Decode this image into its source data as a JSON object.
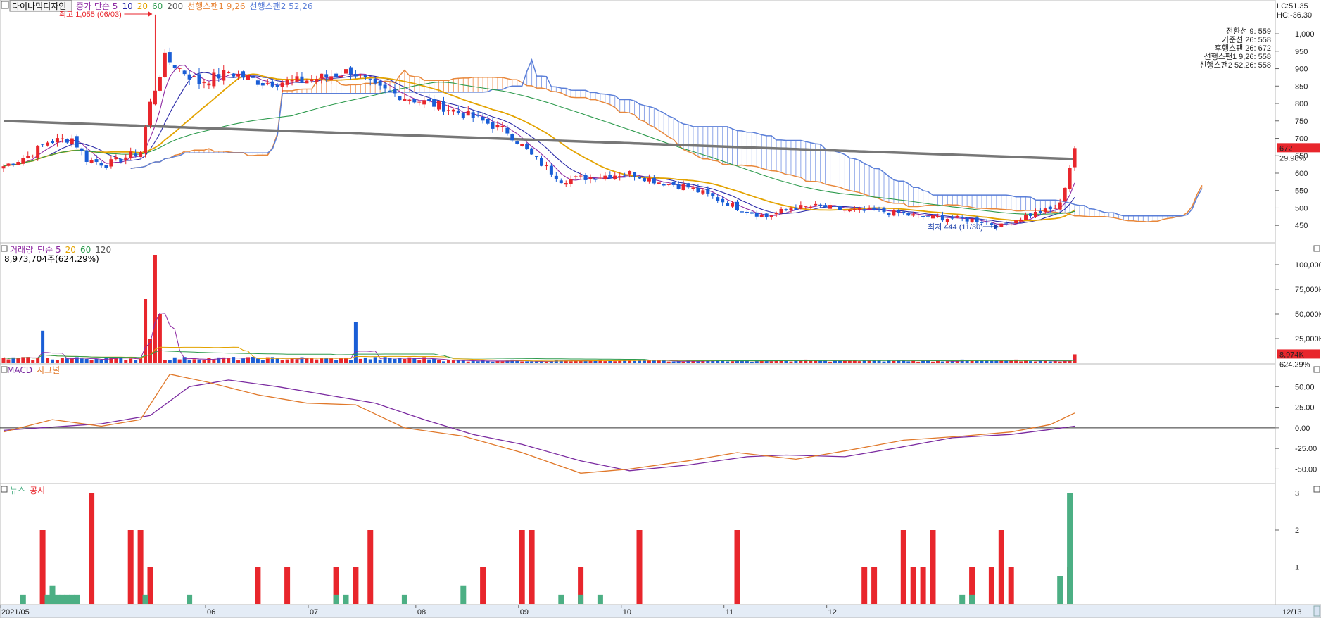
{
  "colors": {
    "up": "#e8262c",
    "down": "#1a5ed6",
    "ma5": "#8e2aa2",
    "ma10": "#2a2aa8",
    "ma20": "#e3a300",
    "ma60": "#2e9b4e",
    "ma200": "#777777",
    "span1": "#e8873a",
    "span2": "#5b7fd8",
    "tenkan": "#2e8b57",
    "kijun": "#555555",
    "chikou": "#8e2aa2",
    "macd": "#7a2aa0",
    "signal": "#e0782a",
    "news": "#4caf84",
    "disclosure": "#e8262c"
  },
  "price_panel": {
    "stock_name": "다이나믹디자인",
    "legend": [
      {
        "text": "종가 단순 5",
        "color": "#8e2aa2"
      },
      {
        "text": "10",
        "color": "#2a2aa8"
      },
      {
        "text": "20",
        "color": "#e3a300"
      },
      {
        "text": "60",
        "color": "#2e9b4e"
      },
      {
        "text": "200",
        "color": "#555555"
      },
      {
        "text": "선행스팬1 9,26",
        "color": "#e8873a"
      },
      {
        "text": "선행스팬2 52,26",
        "color": "#5b7fd8"
      }
    ],
    "lc": "LC:51.35",
    "hc": "HC:-36.30",
    "high_note": "최고 1,055 (06/03)",
    "low_note": "최저 444 (11/30)",
    "ichimoku_labels": [
      {
        "text": "전환선 9: 559",
        "color": "#2e8b57"
      },
      {
        "text": "기준선 26: 558",
        "color": "#555555"
      },
      {
        "text": "후행스팬 26: 672",
        "color": "#8e2aa2"
      },
      {
        "text": "선행스팬1 9,26: 558",
        "color": "#e8873a"
      },
      {
        "text": "선행스팬2 52,26: 558",
        "color": "#5b7fd8"
      }
    ],
    "last_price_label": "672",
    "last_change_label": "29.98%"
  },
  "volume_panel": {
    "legend": [
      {
        "text": "거래량",
        "color": "#8e2aa2"
      },
      {
        "text": "단순 5",
        "color": "#8e2aa2"
      },
      {
        "text": "20",
        "color": "#e3a300"
      },
      {
        "text": "60",
        "color": "#2e9b4e"
      },
      {
        "text": "120",
        "color": "#555555"
      }
    ],
    "last_volume_text": "8,973,704주(624.29%)",
    "last_volume_label": "8,974K",
    "last_volume_pct": "624.29%"
  },
  "macd_panel": {
    "legend": [
      {
        "text": "MACD",
        "color": "#7a2aa0"
      },
      {
        "text": "시그널",
        "color": "#e0782a"
      }
    ]
  },
  "news_panel": {
    "legend": [
      {
        "text": "뉴스",
        "color": "#4caf84"
      },
      {
        "text": "공시",
        "color": "#e8262c"
      }
    ]
  },
  "x_axis": {
    "labels": [
      "2021/05",
      "06",
      "07",
      "08",
      "09",
      "10",
      "11",
      "12"
    ],
    "end_label": "12/13"
  },
  "chart_data": [
    {
      "type": "candlestick",
      "title": "다이나믹디자인",
      "ylim": [
        410,
        1085
      ],
      "y_ticks": [
        "1,000",
        "950",
        "900",
        "850",
        "800",
        "750",
        "700",
        "650",
        "600",
        "550",
        "500",
        "450"
      ],
      "y_tick_values": [
        1000,
        950,
        900,
        850,
        800,
        750,
        700,
        650,
        600,
        550,
        500,
        450
      ],
      "price_anchors": [
        [
          0,
          620
        ],
        [
          5,
          650
        ],
        [
          9,
          690
        ],
        [
          14,
          700
        ],
        [
          17,
          640
        ],
        [
          21,
          625
        ],
        [
          28,
          662
        ],
        [
          30,
          800
        ],
        [
          33,
          930
        ],
        [
          36,
          900
        ],
        [
          40,
          860
        ],
        [
          46,
          890
        ],
        [
          53,
          860
        ],
        [
          61,
          865
        ],
        [
          67,
          880
        ],
        [
          71,
          895
        ],
        [
          76,
          845
        ],
        [
          83,
          815
        ],
        [
          90,
          790
        ],
        [
          96,
          760
        ],
        [
          103,
          720
        ],
        [
          108,
          650
        ],
        [
          114,
          580
        ],
        [
          121,
          590
        ],
        [
          128,
          600
        ],
        [
          134,
          575
        ],
        [
          140,
          560
        ],
        [
          146,
          525
        ],
        [
          151,
          495
        ],
        [
          156,
          475
        ],
        [
          161,
          500
        ],
        [
          167,
          505
        ],
        [
          173,
          492
        ],
        [
          180,
          490
        ],
        [
          187,
          476
        ],
        [
          194,
          470
        ],
        [
          199,
          465
        ],
        [
          204,
          448
        ],
        [
          209,
          478
        ],
        [
          214,
          495
        ],
        [
          216,
          510
        ],
        [
          219,
          672
        ]
      ],
      "candle_count": 220,
      "high_marker": {
        "index": 31,
        "value": 1055
      },
      "low_marker": {
        "index": 204,
        "value": 444
      },
      "last": {
        "price": 672,
        "change_pct": 29.98
      },
      "moving_averages": [
        "5",
        "10",
        "20",
        "60",
        "200"
      ],
      "ichimoku": {
        "span1_label": "선행스팬1 9,26",
        "span2_label": "선행스팬2 52,26"
      }
    },
    {
      "type": "bar",
      "title": "거래량",
      "ylim": [
        0,
        110000
      ],
      "y_ticks": [
        "100,000K",
        "75,000K",
        "50,000K",
        "25,000K"
      ],
      "y_tick_values": [
        100000,
        75000,
        50000,
        25000
      ],
      "unit": "K",
      "spikes": [
        {
          "index": 8,
          "value": 33000
        },
        {
          "index": 29,
          "value": 65000
        },
        {
          "index": 31,
          "value": 110000
        },
        {
          "index": 32,
          "value": 50000
        },
        {
          "index": 30,
          "value": 25000
        },
        {
          "index": 72,
          "value": 42000
        },
        {
          "index": 219,
          "value": 8974
        }
      ]
    },
    {
      "type": "line",
      "title": "MACD",
      "ylim": [
        -65,
        75
      ],
      "y_ticks": [
        "50.00",
        "25.00",
        "0.00",
        "-25.00",
        "-50.00"
      ],
      "y_tick_values": [
        50,
        25,
        0,
        -25,
        -50
      ],
      "series": [
        {
          "name": "MACD",
          "points": [
            [
              0,
              -3
            ],
            [
              20,
              5
            ],
            [
              30,
              15
            ],
            [
              38,
              50
            ],
            [
              46,
              58
            ],
            [
              56,
              50
            ],
            [
              66,
              40
            ],
            [
              76,
              30
            ],
            [
              86,
              10
            ],
            [
              96,
              -8
            ],
            [
              106,
              -20
            ],
            [
              118,
              -40
            ],
            [
              128,
              -52
            ],
            [
              140,
              -45
            ],
            [
              152,
              -35
            ],
            [
              160,
              -33
            ],
            [
              172,
              -35
            ],
            [
              182,
              -25
            ],
            [
              194,
              -12
            ],
            [
              206,
              -8
            ],
            [
              214,
              -2
            ],
            [
              219,
              2
            ]
          ]
        },
        {
          "name": "시그널",
          "points": [
            [
              0,
              -5
            ],
            [
              10,
              10
            ],
            [
              20,
              2
            ],
            [
              28,
              10
            ],
            [
              34,
              65
            ],
            [
              42,
              55
            ],
            [
              52,
              40
            ],
            [
              62,
              30
            ],
            [
              72,
              28
            ],
            [
              82,
              0
            ],
            [
              94,
              -10
            ],
            [
              106,
              -30
            ],
            [
              118,
              -55
            ],
            [
              128,
              -50
            ],
            [
              140,
              -40
            ],
            [
              150,
              -30
            ],
            [
              162,
              -38
            ],
            [
              172,
              -28
            ],
            [
              184,
              -15
            ],
            [
              196,
              -10
            ],
            [
              206,
              -5
            ],
            [
              214,
              4
            ],
            [
              219,
              18
            ]
          ]
        }
      ]
    },
    {
      "type": "bar",
      "title": "뉴스 / 공시",
      "ylim": [
        0,
        3.2
      ],
      "y_ticks": [
        "3",
        "2",
        "1"
      ],
      "y_tick_values": [
        3,
        2,
        1
      ],
      "series": [
        {
          "name": "공시",
          "bars": [
            [
              8,
              2
            ],
            [
              18,
              3
            ],
            [
              26,
              2
            ],
            [
              28,
              2
            ],
            [
              30,
              1
            ],
            [
              52,
              1
            ],
            [
              58,
              1
            ],
            [
              68,
              1
            ],
            [
              72,
              1
            ],
            [
              75,
              2
            ],
            [
              98,
              1
            ],
            [
              106,
              2
            ],
            [
              108,
              2
            ],
            [
              118,
              1
            ],
            [
              130,
              2
            ],
            [
              150,
              2
            ],
            [
              176,
              1
            ],
            [
              178,
              1
            ],
            [
              184,
              2
            ],
            [
              186,
              1
            ],
            [
              188,
              1
            ],
            [
              190,
              2
            ],
            [
              198,
              1
            ],
            [
              202,
              1
            ],
            [
              204,
              2
            ],
            [
              206,
              1
            ],
            [
              218,
              1
            ]
          ]
        },
        {
          "name": "뉴스",
          "bars": [
            [
              4,
              0.25
            ],
            [
              9,
              0.25
            ],
            [
              10,
              0.5
            ],
            [
              11,
              0.25
            ],
            [
              12,
              0.25
            ],
            [
              13,
              0.25
            ],
            [
              14,
              0.25
            ],
            [
              15,
              0.25
            ],
            [
              29,
              0.25
            ],
            [
              38,
              0.25
            ],
            [
              68,
              0.25
            ],
            [
              70,
              0.25
            ],
            [
              82,
              0.25
            ],
            [
              94,
              0.5
            ],
            [
              114,
              0.25
            ],
            [
              118,
              0.25
            ],
            [
              122,
              0.25
            ],
            [
              196,
              0.25
            ],
            [
              198,
              0.25
            ],
            [
              216,
              0.75
            ],
            [
              218,
              3
            ]
          ]
        }
      ]
    }
  ]
}
